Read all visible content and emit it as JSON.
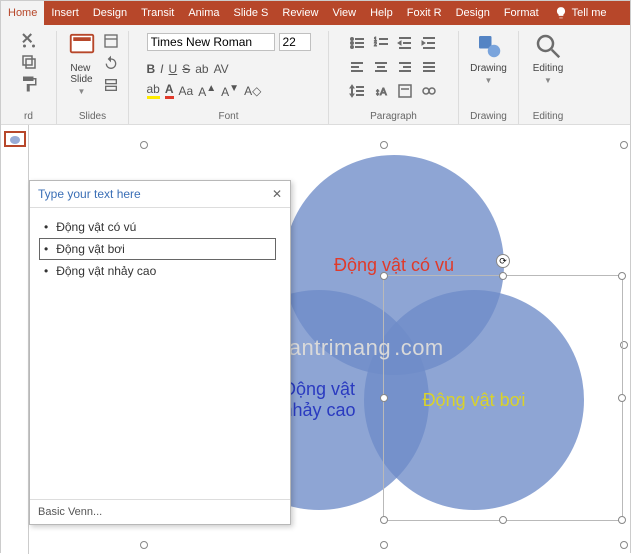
{
  "tabs": [
    "Home",
    "Insert",
    "Design",
    "Transit",
    "Anima",
    "Slide S",
    "Review",
    "View",
    "Help",
    "Foxit R",
    "Design",
    "Format"
  ],
  "tellme": "Tell me",
  "ribbon": {
    "clipboard": {
      "label": "rd"
    },
    "slides": {
      "label": "Slides",
      "newslide": "New\nSlide"
    },
    "font": {
      "label": "Font",
      "name": "Times New Roman",
      "size": "22"
    },
    "paragraph": {
      "label": "Paragraph"
    },
    "drawing": {
      "label": "Drawing",
      "btn": "Drawing"
    },
    "editing": {
      "label": "Editing",
      "btn": "Editing"
    }
  },
  "textpane": {
    "title": "Type your text here",
    "items": [
      "Động vật có vú",
      "Động vật bơi",
      "Động vật nhảy cao"
    ],
    "footer": "Basic Venn..."
  },
  "circles": {
    "c1": {
      "text": "Động vật có vú",
      "color": "#e03a2a"
    },
    "c2": {
      "text": "Động vật\nnhảy cao",
      "color": "#2a3ac0"
    },
    "c3": {
      "text": "Động vật bơi",
      "color": "#c9c22a"
    }
  },
  "watermark": "uantrimang"
}
